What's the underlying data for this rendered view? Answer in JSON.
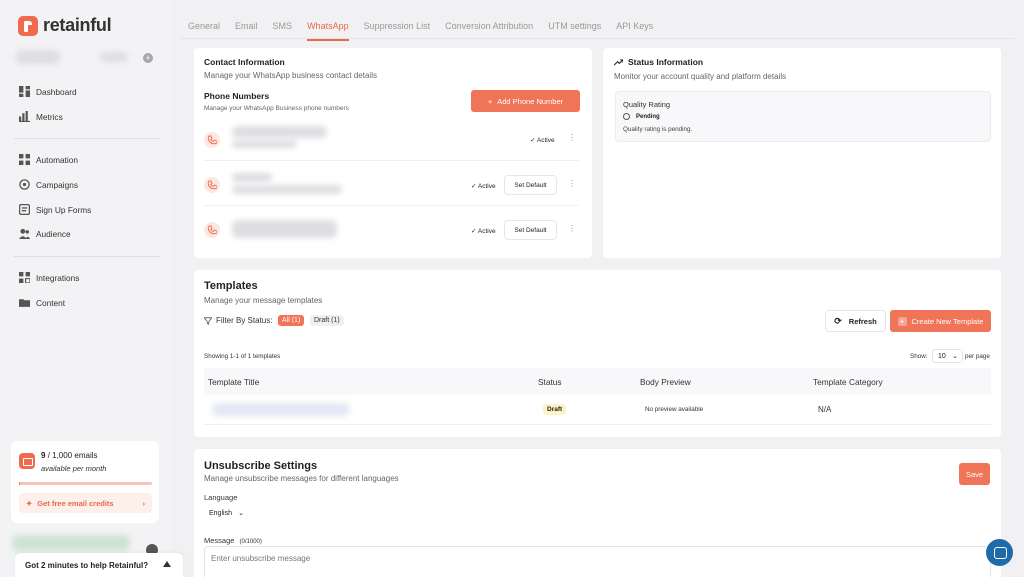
{
  "app": {
    "brand": "retainful"
  },
  "sidebar": {
    "items": [
      {
        "label": "Dashboard",
        "icon": "dashboard-icon"
      },
      {
        "label": "Metrics",
        "icon": "metrics-icon"
      },
      {
        "label": "Automation",
        "icon": "automation-icon"
      },
      {
        "label": "Campaigns",
        "icon": "campaigns-icon"
      },
      {
        "label": "Sign Up Forms",
        "icon": "forms-icon"
      },
      {
        "label": "Audience",
        "icon": "audience-icon"
      },
      {
        "label": "Integrations",
        "icon": "integrations-icon"
      },
      {
        "label": "Content",
        "icon": "folder-icon"
      }
    ],
    "credits": {
      "used": "9",
      "total": "/ 1,000 emails",
      "period": "available per month",
      "usage_fraction": 0.009,
      "cta": "Get free email credits"
    },
    "help": "Got 2 minutes to help Retainful?"
  },
  "tabs": [
    "General",
    "Email",
    "SMS",
    "WhatsApp",
    "Suppression List",
    "Conversion Attribution",
    "UTM settings",
    "API Keys"
  ],
  "active_tab": "WhatsApp",
  "contact": {
    "title": "Contact Information",
    "subtitle": "Manage your WhatsApp business contact details",
    "phones_title": "Phone Numbers",
    "phones_subtitle": "Manage your WhatsApp Business phone numbers",
    "add_button": "Add Phone Number",
    "phones": [
      {
        "status": "Active",
        "set_default": ""
      },
      {
        "status": "Active",
        "set_default": "Set Default"
      },
      {
        "status": "Active",
        "set_default": "Set Default"
      }
    ]
  },
  "status_info": {
    "title": "Status Information",
    "subtitle": "Monitor your account quality and platform details",
    "quality_label": "Quality Rating",
    "quality_value": "Pending",
    "quality_note": "Quality rating is pending."
  },
  "templates": {
    "title": "Templates",
    "subtitle": "Manage your message templates",
    "filter_label": "Filter By Status:",
    "filter_all": "All (1)",
    "filter_draft": "Draft (1)",
    "refresh": "Refresh",
    "create": "Create New Template",
    "showing": "Showing 1-1 of 1 templates",
    "show_label": "Show:",
    "show_value": "10",
    "per_page": "per page",
    "columns": [
      "Template Title",
      "Status",
      "Body Preview",
      "Template Category"
    ],
    "rows": [
      {
        "status": "Draft",
        "preview": "No preview available",
        "category": "N/A"
      }
    ]
  },
  "unsubscribe": {
    "title": "Unsubscribe Settings",
    "subtitle": "Manage unsubscribe messages for different languages",
    "save": "Save",
    "language_label": "Language",
    "language_value": "English",
    "message_label": "Message",
    "message_count": "(0/1000)",
    "message_placeholder": "Enter unsubscribe message"
  },
  "colors": {
    "accent": "#f06b4e",
    "active_tab": "#e8694b",
    "draft_badge": "#fdf3c8"
  }
}
